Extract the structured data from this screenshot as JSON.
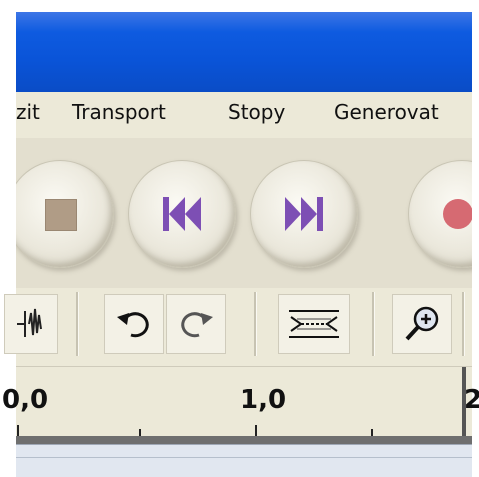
{
  "menu": {
    "items": [
      "zit",
      "Transport",
      "Stopy",
      "Generovat"
    ]
  },
  "transport": {
    "buttons": [
      "stop",
      "skip-to-start",
      "skip-to-end",
      "record"
    ]
  },
  "toolbar": {
    "tools": [
      "audio-edit",
      "undo",
      "redo",
      "fit-selection",
      "zoom-in"
    ]
  },
  "ruler": {
    "labels": [
      "0,0",
      "1,0",
      "2"
    ]
  },
  "colors": {
    "titlebar": "#0a54d8",
    "transport_glyph": "#7d4fb4",
    "stop": "#b09c86",
    "record": "#d66a72"
  }
}
